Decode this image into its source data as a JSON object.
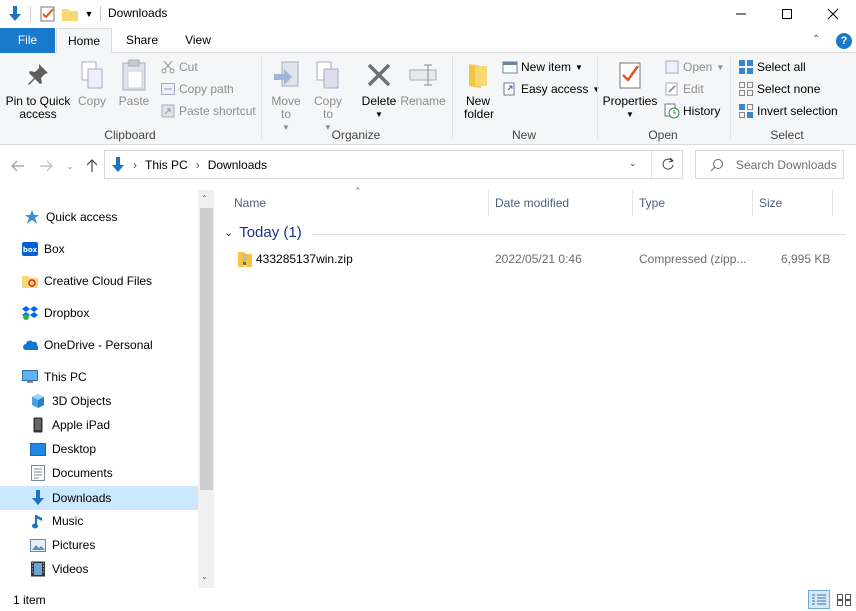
{
  "window": {
    "title": "Downloads",
    "controls": {
      "minimize": "—",
      "maximize": "☐",
      "close": "✕"
    }
  },
  "ribbon_tabs": [
    "File",
    "Home",
    "Share",
    "View"
  ],
  "ribbon": {
    "clipboard": {
      "label": "Clipboard",
      "pin": "Pin to Quick access",
      "copy": "Copy",
      "paste": "Paste",
      "cut": "Cut",
      "copy_path": "Copy path",
      "paste_shortcut": "Paste shortcut"
    },
    "organize": {
      "label": "Organize",
      "move_to": "Move to",
      "copy_to": "Copy to",
      "delete": "Delete",
      "rename": "Rename"
    },
    "new": {
      "label": "New",
      "new_folder": "New folder",
      "new_item": "New item",
      "easy_access": "Easy access"
    },
    "open": {
      "label": "Open",
      "properties": "Properties",
      "open": "Open",
      "edit": "Edit",
      "history": "History"
    },
    "select": {
      "label": "Select",
      "select_all": "Select all",
      "select_none": "Select none",
      "invert": "Invert selection"
    }
  },
  "address": {
    "crumbs": [
      "This PC",
      "Downloads"
    ],
    "search_placeholder": "Search Downloads"
  },
  "nav": {
    "items": [
      {
        "label": "Quick access",
        "icon": "star-icon"
      },
      {
        "label": "Box",
        "icon": "box-icon"
      },
      {
        "label": "Creative Cloud Files",
        "icon": "creative-cloud-icon"
      },
      {
        "label": "Dropbox",
        "icon": "dropbox-icon"
      },
      {
        "label": "OneDrive - Personal",
        "icon": "onedrive-icon"
      },
      {
        "label": "This PC",
        "icon": "pc-icon"
      },
      {
        "label": "3D Objects",
        "icon": "cube-icon"
      },
      {
        "label": "Apple iPad",
        "icon": "ipad-icon"
      },
      {
        "label": "Desktop",
        "icon": "desktop-icon"
      },
      {
        "label": "Documents",
        "icon": "documents-icon"
      },
      {
        "label": "Downloads",
        "icon": "download-icon"
      },
      {
        "label": "Music",
        "icon": "music-icon"
      },
      {
        "label": "Pictures",
        "icon": "pictures-icon"
      },
      {
        "label": "Videos",
        "icon": "videos-icon"
      }
    ],
    "selected": "Downloads"
  },
  "files": {
    "columns": [
      "Name",
      "Date modified",
      "Type",
      "Size"
    ],
    "group": "Today (1)",
    "rows": [
      {
        "name": "433285137win.zip",
        "date": "2022/05/21 0:46",
        "type": "Compressed (zipp...",
        "size": "6,995 KB"
      }
    ]
  },
  "status": {
    "count": "1 item"
  },
  "colors": {
    "accent": "#1979ca",
    "selected_bg": "#cce8ff",
    "group_header": "#1e3287"
  }
}
